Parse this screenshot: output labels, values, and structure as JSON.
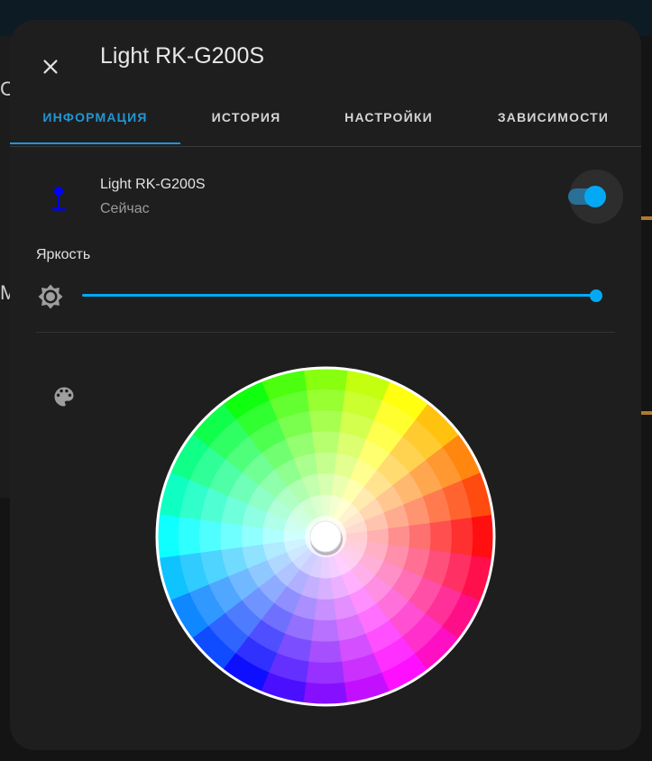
{
  "background": {
    "letter_c": "С",
    "letter_m": "М"
  },
  "dialog": {
    "title": "Light RK-G200S",
    "close_icon": "close-icon"
  },
  "tabs": [
    {
      "label": "ИНФОРМАЦИЯ",
      "active": true
    },
    {
      "label": "ИСТОРИЯ",
      "active": false
    },
    {
      "label": "НАСТРОЙКИ",
      "active": false
    },
    {
      "label": "ЗАВИСИМОСТИ",
      "active": false
    }
  ],
  "entity": {
    "name": "Light RK-G200S",
    "last_changed": "Сейчас",
    "icon": "floor-lamp-icon",
    "icon_color": "#0000ff",
    "state_on": true
  },
  "brightness": {
    "label": "Яркость",
    "icon": "brightness-icon",
    "value_percent": 100
  },
  "color": {
    "icon": "palette-icon",
    "selected_hue_deg": 0,
    "selected_saturation": 0
  },
  "colors": {
    "accent": "#03a9f4",
    "tab_active": "#2196d3",
    "dialog_bg": "#1e1e1e"
  }
}
